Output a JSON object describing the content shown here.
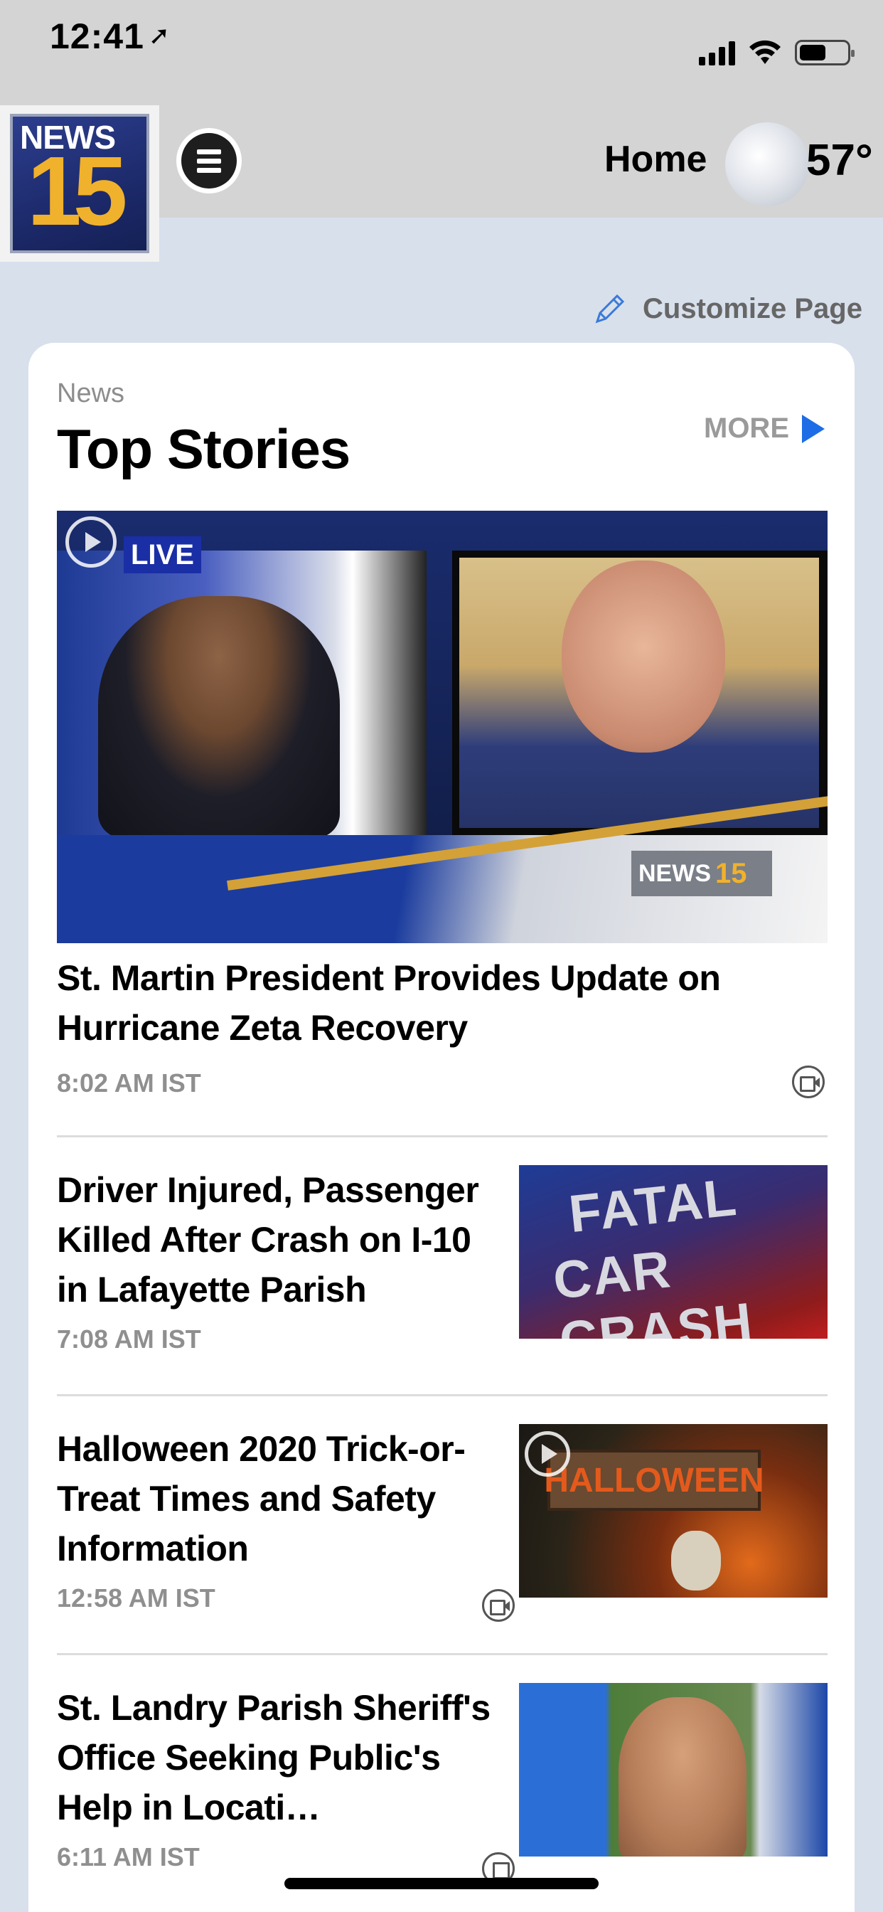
{
  "status_bar": {
    "time": "12:41"
  },
  "header": {
    "logo_top": "NEWS",
    "logo_number": "15",
    "home_label": "Home",
    "temperature": "57°"
  },
  "customize": {
    "label": "Customize Page"
  },
  "section": {
    "kicker": "News",
    "title": "Top Stories",
    "more_label": "MORE"
  },
  "hero": {
    "live_label": "LIVE",
    "bug_text": "NEWS",
    "bug_number": "15",
    "headline": "St. Martin President Provides Update on Hurricane Zeta Recovery",
    "timestamp": "8:02 AM IST"
  },
  "stories": [
    {
      "headline": "Driver Injured, Passenger Killed After Crash on I-10 in Lafayette Parish",
      "timestamp": "7:08 AM IST",
      "thumb_line1": "FATAL",
      "thumb_line2": "CAR CRASH"
    },
    {
      "headline": "Halloween 2020 Trick-or-Treat Times and Safety Information",
      "timestamp": "12:58 AM IST",
      "thumb_line1": "HALLOWEEN"
    },
    {
      "headline": "St. Landry Parish Sheriff's Office Seeking Public's Help in Locati…",
      "timestamp": "6:11 AM IST"
    }
  ],
  "colors": {
    "accent_blue": "#1e6de6",
    "page_background": "#d8e0ec",
    "header_background": "#d4d4d4"
  }
}
